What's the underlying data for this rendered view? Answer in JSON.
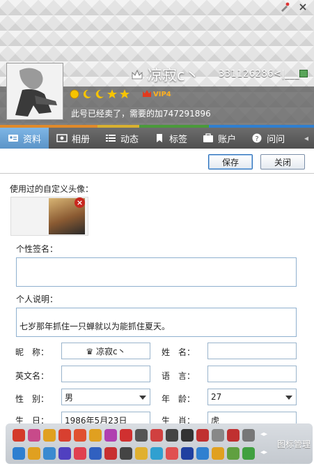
{
  "profile": {
    "nickname": "凉寂c丶",
    "qq_number": "331126286<|___",
    "vip": "VIP4",
    "signature": "此号已经卖了，需要的加747291896"
  },
  "tabs": [
    {
      "label": "资料",
      "icon": "id-card-icon"
    },
    {
      "label": "相册",
      "icon": "photo-icon"
    },
    {
      "label": "动态",
      "icon": "list-icon"
    },
    {
      "label": "标签",
      "icon": "bookmark-icon"
    },
    {
      "label": "账户",
      "icon": "wallet-icon"
    },
    {
      "label": "问问",
      "icon": "question-icon"
    }
  ],
  "actions": {
    "save": "保存",
    "close": "关闭"
  },
  "used_avatars_label": "使用过的自定义头像：",
  "personal_signature_label": "个性签名：",
  "personal_signature_value": "",
  "personal_desc_label": "个人说明：",
  "personal_desc_value": "七岁那年抓住一只蝉就以为能抓住夏天。",
  "fields": {
    "nickname_label": "昵　称：",
    "nickname_value": "♛ 凉寂c丶",
    "name_label": "姓　名：",
    "name_value": "",
    "english_label": "英文名：",
    "english_value": "",
    "language_label": "语　言：",
    "language_value": "",
    "gender_label": "性　别：",
    "gender_value": "男",
    "age_label": "年　龄：",
    "age_value": "27",
    "birthday_label": "生　日：",
    "birthday_value": "1986年5月23日",
    "zodiac_label": "生　肖：",
    "zodiac_value": "虎"
  },
  "icon_manage": "图标管理"
}
